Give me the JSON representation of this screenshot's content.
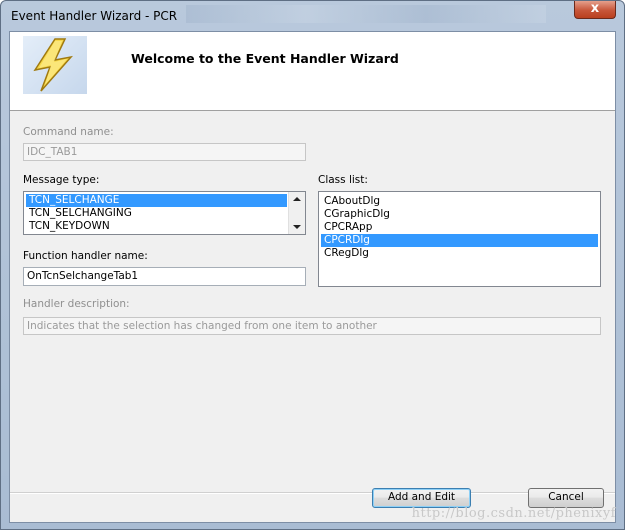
{
  "window": {
    "title": "Event Handler Wizard - PCR",
    "close_glyph": "x"
  },
  "banner": {
    "icon": "lightning-bolt-icon",
    "heading": "Welcome to the Event Handler Wizard"
  },
  "command": {
    "label": "Command name:",
    "value": "IDC_TAB1"
  },
  "message": {
    "label": "Message type:",
    "items": [
      "TCN_SELCHANGE",
      "TCN_SELCHANGING",
      "TCN_KEYDOWN"
    ],
    "selected_index": 0
  },
  "classlist": {
    "label": "Class list:",
    "items": [
      "CAboutDlg",
      "CGraphicDlg",
      "CPCRApp",
      "CPCRDlg",
      "CRegDlg"
    ],
    "selected_index": 3
  },
  "handler": {
    "label": "Function handler name:",
    "value": "OnTcnSelchangeTab1"
  },
  "description": {
    "label": "Handler description:",
    "value": "Indicates that the selection has changed from one item to another"
  },
  "buttons": {
    "add_edit": "Add and Edit",
    "cancel": "Cancel"
  },
  "watermark": "http://blog.csdn.net/phenixyf",
  "colors": {
    "selection": "#3399ff",
    "close_button": "#c7563a",
    "titlebar": "#b9c9dc"
  }
}
